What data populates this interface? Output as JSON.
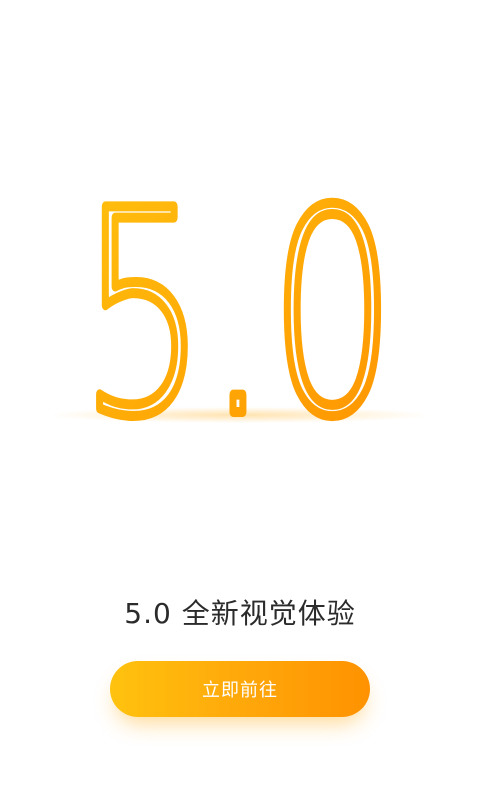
{
  "hero": {
    "version_text": "5.0",
    "colors": {
      "gradient_start": "#ffc20e",
      "gradient_end": "#ff9200"
    }
  },
  "tagline": "5.0 全新视觉体验",
  "cta": {
    "label": "立即前往"
  }
}
